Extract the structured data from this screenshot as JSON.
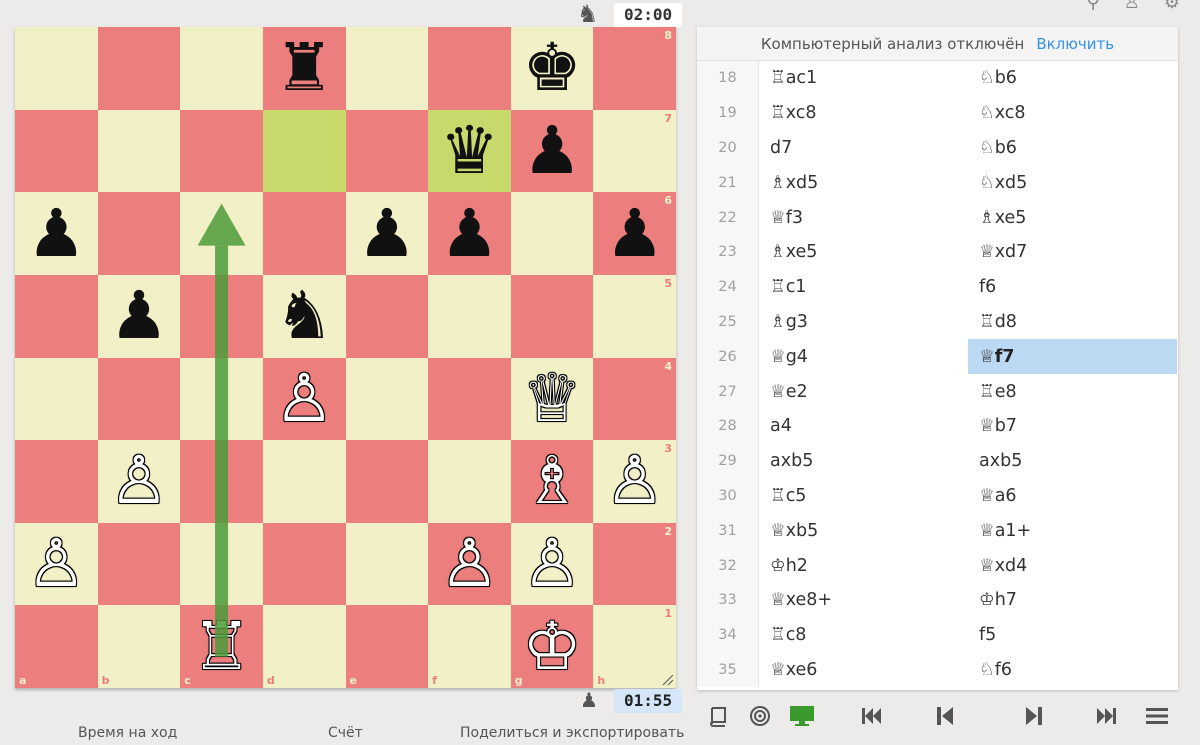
{
  "clocks": {
    "top": "02:00",
    "bottom": "01:55"
  },
  "board": {
    "files": [
      "a",
      "b",
      "c",
      "d",
      "e",
      "f",
      "g",
      "h"
    ],
    "ranks": [
      "8",
      "7",
      "6",
      "5",
      "4",
      "3",
      "2",
      "1"
    ],
    "highlight": [
      "d7",
      "f7"
    ],
    "arrow": {
      "from": "c1",
      "to": "c6",
      "color": "#4d9b3a"
    },
    "pieces": [
      {
        "square": "d8",
        "color": "b",
        "type": "rook",
        "glyph": "♜"
      },
      {
        "square": "g8",
        "color": "b",
        "type": "king",
        "glyph": "♚"
      },
      {
        "square": "f7",
        "color": "b",
        "type": "queen",
        "glyph": "♛"
      },
      {
        "square": "g7",
        "color": "b",
        "type": "pawn",
        "glyph": "♟"
      },
      {
        "square": "a6",
        "color": "b",
        "type": "pawn",
        "glyph": "♟"
      },
      {
        "square": "e6",
        "color": "b",
        "type": "pawn",
        "glyph": "♟"
      },
      {
        "square": "f6",
        "color": "b",
        "type": "pawn",
        "glyph": "♟"
      },
      {
        "square": "h6",
        "color": "b",
        "type": "pawn",
        "glyph": "♟"
      },
      {
        "square": "b5",
        "color": "b",
        "type": "pawn",
        "glyph": "♟"
      },
      {
        "square": "d5",
        "color": "b",
        "type": "knight",
        "glyph": "♞"
      },
      {
        "square": "d4",
        "color": "w",
        "type": "pawn",
        "glyph": "♙"
      },
      {
        "square": "g4",
        "color": "w",
        "type": "queen",
        "glyph": "♕"
      },
      {
        "square": "b3",
        "color": "w",
        "type": "pawn",
        "glyph": "♙"
      },
      {
        "square": "g3",
        "color": "w",
        "type": "bishop",
        "glyph": "♗"
      },
      {
        "square": "h3",
        "color": "w",
        "type": "pawn",
        "glyph": "♙"
      },
      {
        "square": "a2",
        "color": "w",
        "type": "pawn",
        "glyph": "♙"
      },
      {
        "square": "f2",
        "color": "w",
        "type": "pawn",
        "glyph": "♙"
      },
      {
        "square": "g2",
        "color": "w",
        "type": "pawn",
        "glyph": "♙"
      },
      {
        "square": "c1",
        "color": "w",
        "type": "rook",
        "glyph": "♖"
      },
      {
        "square": "g1",
        "color": "w",
        "type": "king",
        "glyph": "♔"
      }
    ]
  },
  "bottom_tabs": [
    "Время на ход",
    "Счёт",
    "Поделиться и экспортировать"
  ],
  "panel": {
    "analysis_text": "Компьютерный анализ отключён",
    "enable_label": "Включить",
    "current_move": {
      "index": 26,
      "side": "black"
    },
    "moves": [
      {
        "n": "18",
        "w": "♖ac1",
        "b": "♘b6"
      },
      {
        "n": "19",
        "w": "♖xc8",
        "b": "♘xc8"
      },
      {
        "n": "20",
        "w": "d7",
        "b": "♘b6"
      },
      {
        "n": "21",
        "w": "♗xd5",
        "b": "♘xd5"
      },
      {
        "n": "22",
        "w": "♕f3",
        "b": "♗xe5"
      },
      {
        "n": "23",
        "w": "♗xe5",
        "b": "♕xd7"
      },
      {
        "n": "24",
        "w": "♖c1",
        "b": "f6"
      },
      {
        "n": "25",
        "w": "♗g3",
        "b": "♖d8"
      },
      {
        "n": "26",
        "w": "♕g4",
        "b": "♕f7"
      },
      {
        "n": "27",
        "w": "♕e2",
        "b": "♖e8"
      },
      {
        "n": "28",
        "w": "a4",
        "b": "♕b7"
      },
      {
        "n": "29",
        "w": "axb5",
        "b": "axb5"
      },
      {
        "n": "30",
        "w": "♖c5",
        "b": "♕a6"
      },
      {
        "n": "31",
        "w": "♕xb5",
        "b": "♕a1+"
      },
      {
        "n": "32",
        "w": "♔h2",
        "b": "♕xd4"
      },
      {
        "n": "33",
        "w": "♕xe8+",
        "b": "♔h7"
      },
      {
        "n": "34",
        "w": "♖c8",
        "b": "f5"
      },
      {
        "n": "35",
        "w": "♕xe6",
        "b": "♘f6"
      }
    ]
  },
  "icons": {
    "top_clock_piece": "♞",
    "bottom_clock_piece": "♟",
    "controls": [
      "book-icon",
      "target-icon",
      "monitor-icon",
      "first-move-icon",
      "prev-move-icon",
      "next-move-icon",
      "last-move-icon",
      "menu-icon"
    ]
  },
  "colors": {
    "light_square": "#f1f0c6",
    "dark_square": "#ec7e7e",
    "highlight": "#c6d96a",
    "current_move": "#bcd9f3",
    "link": "#3692e7",
    "monitor_active": "#3b9a2d"
  }
}
